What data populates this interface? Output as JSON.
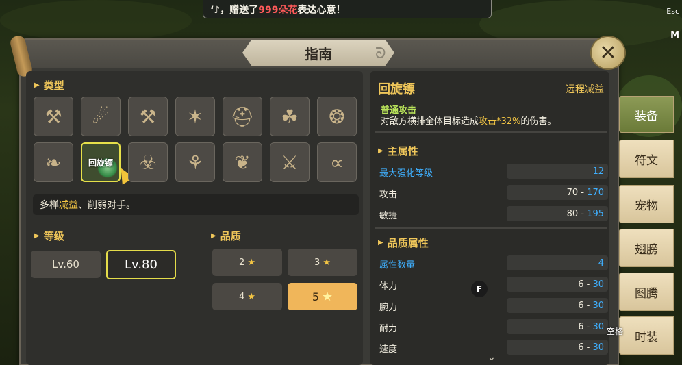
{
  "notice": {
    "prefix": "‘♪，赠送了",
    "highlight": "999朵花",
    "suffix": "表达心意！"
  },
  "corner": {
    "esc": "Esc",
    "m": "M"
  },
  "panel": {
    "title": "指南"
  },
  "left": {
    "type_label": "类型",
    "items_row1": [
      {
        "icon": "⚒"
      },
      {
        "icon": "☄"
      },
      {
        "icon": "⚒"
      },
      {
        "icon": "✶"
      },
      {
        "icon": "⛑"
      },
      {
        "icon": "☘"
      },
      {
        "icon": "❂"
      }
    ],
    "items_row2": [
      {
        "icon": "❧"
      },
      {
        "label": "回旋镖"
      },
      {
        "icon": "☣"
      },
      {
        "icon": "⚘"
      },
      {
        "icon": "❦"
      },
      {
        "icon": "⚔"
      },
      {
        "icon": "∝"
      }
    ],
    "desc_plain": "多样",
    "desc_hl": "减益",
    "desc_rest": "、削弱对手。",
    "level_label": "等级",
    "levels": [
      "Lv.60",
      "Lv.80"
    ],
    "selected_level": "Lv.80",
    "quality_label": "品质",
    "qualities": [
      "2",
      "3",
      "4",
      "5"
    ],
    "selected_quality": "5"
  },
  "right": {
    "name": "回旋镖",
    "type": "远程减益",
    "attack_title": "普通攻击",
    "attack_desc_pre": "对敌方横排全体目标造成",
    "attack_desc_hl": "攻击*32%",
    "attack_desc_post": "的伤害。",
    "main_attr_title": "主属性",
    "main_attrs": [
      {
        "label": "最大强化等级",
        "value": "12"
      },
      {
        "label": "攻击",
        "min": "70",
        "max": "170"
      },
      {
        "label": "敏捷",
        "min": "80",
        "max": "195"
      }
    ],
    "quality_attr_title": "品质属性",
    "attr_count_label": "属性数量",
    "attr_count": "4",
    "quality_attrs": [
      {
        "label": "体力",
        "min": "6",
        "max": "30"
      },
      {
        "label": "腕力",
        "min": "6",
        "max": "30"
      },
      {
        "label": "耐力",
        "min": "6",
        "max": "30"
      },
      {
        "label": "速度",
        "min": "6",
        "max": "30"
      }
    ],
    "dash": "-"
  },
  "tabs": [
    "装备",
    "符文",
    "宠物",
    "翅膀",
    "图腾",
    "时装"
  ],
  "hints": {
    "f_key": "F",
    "space_key": "空格"
  },
  "colors": {
    "gold": "#f0c75a",
    "blue": "#3fb0ff",
    "green": "#b9e35a"
  }
}
